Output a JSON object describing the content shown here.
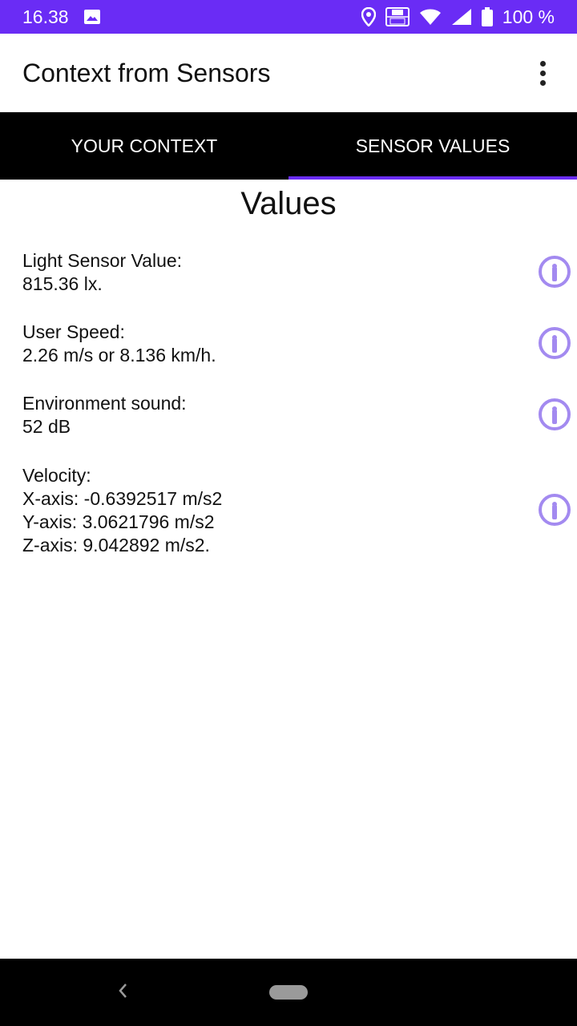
{
  "status_bar": {
    "time": "16.38",
    "volte_label": "VO\nLTE",
    "battery_percent": "100 %"
  },
  "app_bar": {
    "title": "Context from Sensors"
  },
  "tabs": [
    {
      "label": "YOUR CONTEXT",
      "active": false
    },
    {
      "label": "SENSOR VALUES",
      "active": true
    }
  ],
  "section_title": "Values",
  "sensors": [
    {
      "label": "Light Sensor Value:",
      "lines": [
        "815.36 lx."
      ]
    },
    {
      "label": "User Speed:",
      "lines": [
        "2.26 m/s or 8.136 km/h."
      ]
    },
    {
      "label": "Environment sound:",
      "lines": [
        "52 dB"
      ]
    },
    {
      "label": "Velocity:",
      "lines": [
        "X-axis: -0.6392517 m/s2",
        "Y-axis: 3.0621796 m/s2",
        "Z-axis: 9.042892 m/s2."
      ]
    }
  ],
  "colors": {
    "accent": "#6a2cf5",
    "info_icon": "#a38af0"
  },
  "icons": {
    "image": "image-icon",
    "location": "location-icon",
    "wifi": "wifi-icon",
    "signal": "signal-icon",
    "battery": "battery-icon",
    "overflow": "overflow-menu-icon",
    "info": "info-icon",
    "back": "back-icon",
    "home": "home-icon"
  }
}
